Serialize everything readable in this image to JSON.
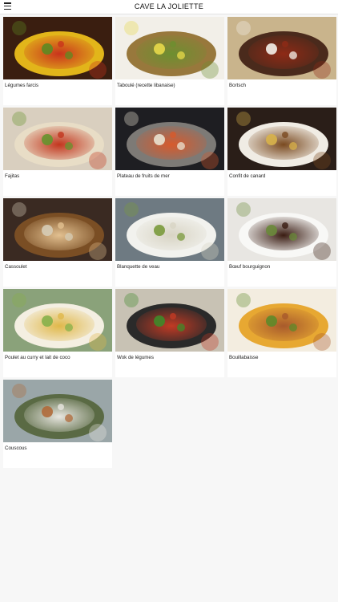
{
  "header": {
    "title": "CAVE LA JOLIETTE",
    "menu_icon": "hamburger-icon"
  },
  "dishes": [
    {
      "name": "Légumes farcis",
      "colors": [
        "#3a1e10",
        "#e2b51a",
        "#c9341c",
        "#5e8a22"
      ]
    },
    {
      "name": "Taboulé (recette libanaise)",
      "colors": [
        "#f2efe8",
        "#98783c",
        "#6d8f30",
        "#e8d94a"
      ]
    },
    {
      "name": "Bortsch",
      "colors": [
        "#c9b48c",
        "#4a2a1c",
        "#8e2a16",
        "#f4f1ea"
      ]
    },
    {
      "name": "Fajitas",
      "colors": [
        "#d9cfbf",
        "#e8ddc6",
        "#c2361e",
        "#66932e"
      ]
    },
    {
      "name": "Plateau de fruits de mer",
      "colors": [
        "#1e1e22",
        "#7d7a76",
        "#d75a2c",
        "#e9e2d0"
      ]
    },
    {
      "name": "Confit de canard",
      "colors": [
        "#2a1e18",
        "#f0ece4",
        "#7a4a20",
        "#d8b24a"
      ]
    },
    {
      "name": "Cassoulet",
      "colors": [
        "#3a2a22",
        "#7a4e24",
        "#e2c090",
        "#d6ccb6"
      ]
    },
    {
      "name": "Blanquette de veau",
      "colors": [
        "#6e7a82",
        "#f2f2ee",
        "#d8d4c4",
        "#7a9a3c"
      ]
    },
    {
      "name": "Bœuf bourguignon",
      "colors": [
        "#e8e6e2",
        "#f8f8f6",
        "#3a1c12",
        "#6a8a3a"
      ]
    },
    {
      "name": "Poulet au curry et lait de coco",
      "colors": [
        "#8aa27a",
        "#f4efe2",
        "#e0b84a",
        "#86b04a"
      ]
    },
    {
      "name": "Wok de légumes",
      "colors": [
        "#c8c2b4",
        "#2a2a2a",
        "#c23a24",
        "#3e8a2a"
      ]
    },
    {
      "name": "Bouillabaisse",
      "colors": [
        "#f3ede0",
        "#e7a832",
        "#a85a2c",
        "#5e8a2a"
      ]
    },
    {
      "name": "Couscous",
      "colors": [
        "#9aa6a8",
        "#5a6a44",
        "#e8e6e0",
        "#b06a3a"
      ]
    }
  ]
}
